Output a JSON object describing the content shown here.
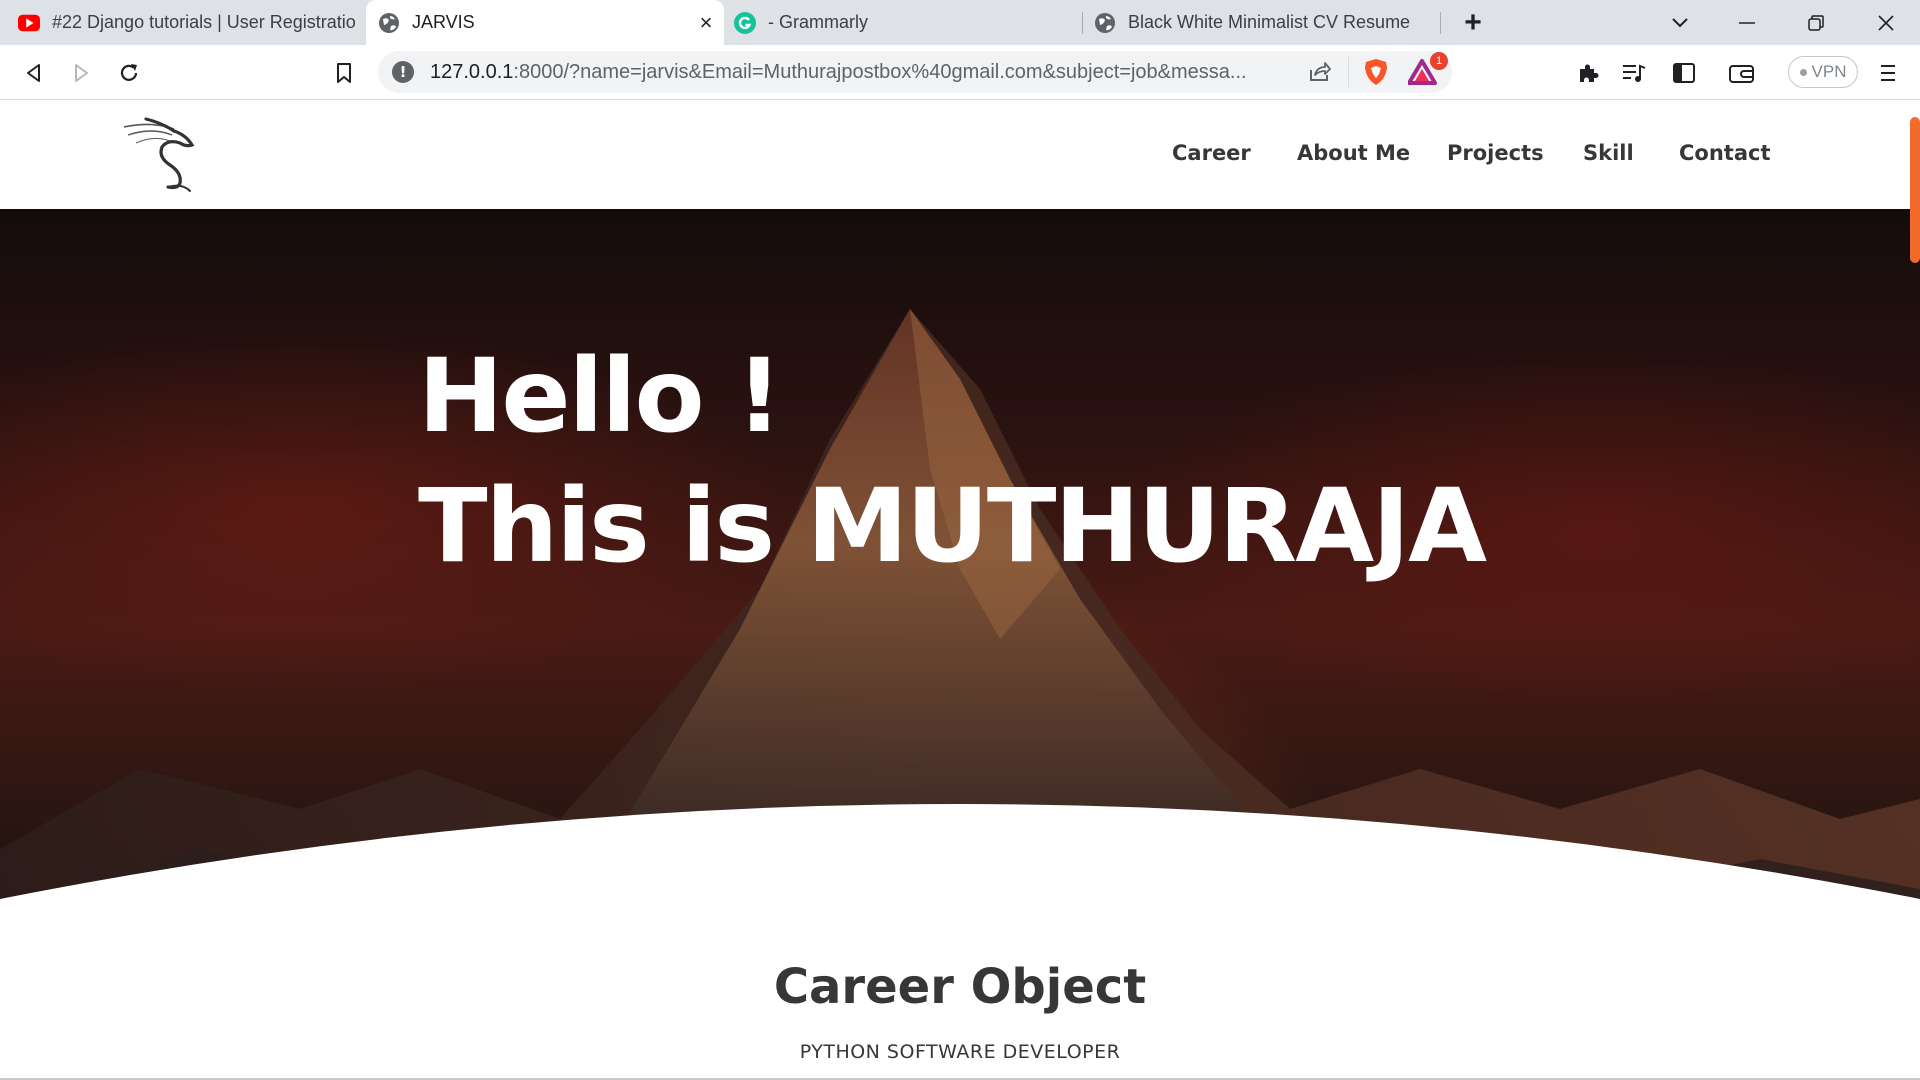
{
  "browser": {
    "tabs": [
      {
        "title": "#22 Django tutorials | User Registratio",
        "icon": "youtube-icon",
        "active": false
      },
      {
        "title": "JARVIS",
        "icon": "globe-icon",
        "active": true
      },
      {
        "title": "- Grammarly",
        "icon": "grammarly-icon",
        "active": false
      },
      {
        "title": "Black White Minimalist CV Resume",
        "icon": "globe-icon",
        "active": false
      }
    ],
    "tab_close_glyph": "×",
    "new_tab_glyph": "+",
    "url_host": "127.0.0.1",
    "url_rest": ":8000/?name=jarvis&Email=Muthurajpostbox%40gmail.com&subject=job&messa...",
    "vpn_label": "VPN",
    "alert_badge_count": "1",
    "accent_color": "#f26b2c"
  },
  "site": {
    "nav": [
      "Career",
      "About Me",
      "Projects",
      "Skill",
      "Contact"
    ],
    "hero_line1": "Hello !",
    "hero_line2": "This is MUTHURAJA",
    "section_title": "Career Object",
    "section_subtitle": "PYTHON SOFTWARE DEVELOPER"
  }
}
